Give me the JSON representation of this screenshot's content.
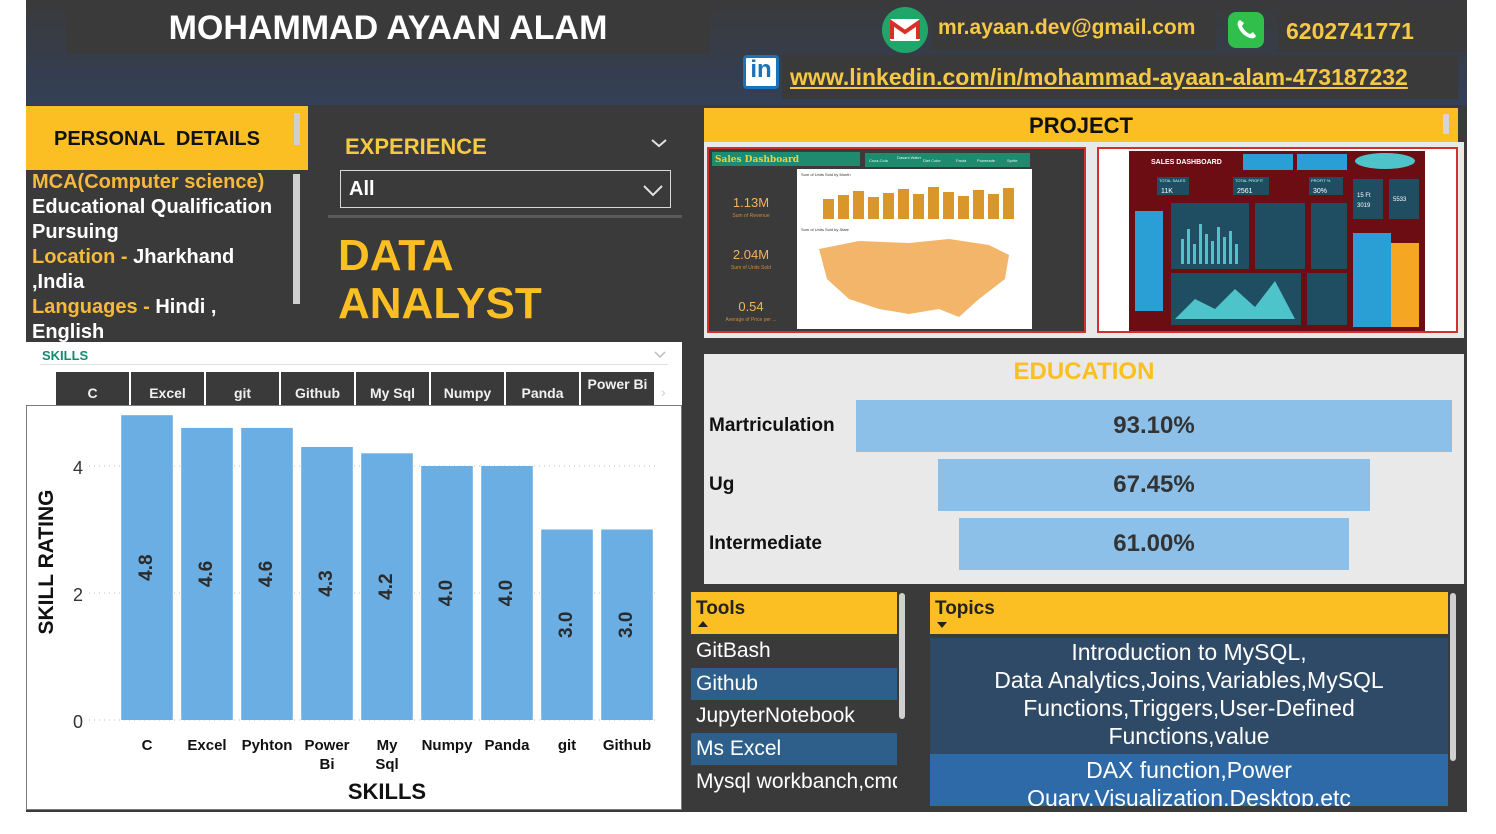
{
  "header": {
    "name": "MOHAMMAD AYAAN ALAM",
    "email": "mr.ayaan.dev@gmail.com",
    "phone": "6202741771",
    "linkedin": "www.linkedin.com/in/mohammad-ayaan-alam-473187232",
    "icons": [
      "gmail-icon",
      "phone-icon",
      "linkedin-icon"
    ]
  },
  "personal_details": {
    "title": "PERSONAL  DETAILS",
    "degree": "MCA(Computer science)",
    "qualification_line1": "Educational Qualification",
    "qualification_line2": "Pursuing",
    "location_label": "Location - ",
    "location_value": "Jharkhand",
    "location_value2": ",India",
    "languages_label": "Languages - ",
    "languages_value": "Hindi ,",
    "languages_value2": "English"
  },
  "experience": {
    "title": "EXPERIENCE",
    "selected": "All",
    "role_line1": "DATA",
    "role_line2": "ANALYST"
  },
  "skills_slicer": {
    "title": "SKILLS",
    "chips": [
      "C",
      "Excel",
      "git",
      "Github",
      "My Sql",
      "Numpy",
      "Panda",
      "Power Bi"
    ]
  },
  "project": {
    "title": "PROJECT",
    "thumb1": {
      "header": "Sales Dashboard",
      "kpis": [
        {
          "value": "1.13M",
          "label": "Sum of Revenue"
        },
        {
          "value": "2.04M",
          "label": "Sum of Units Sold"
        },
        {
          "value": "0.54",
          "label": "Average of Price per ..."
        }
      ],
      "tabs": [
        "Coca-Cola",
        "Dasani Water",
        "Diet Coke",
        "Fanta",
        "Powerade",
        "Sprite"
      ],
      "chart1_title": "Sum of Units Sold by Month",
      "chart2_title": "Sum of Units Sold by State"
    },
    "thumb2": {
      "header": "SALES DASHBOARD",
      "kpis": [
        {
          "label": "TOTAL SALES",
          "value": "11K"
        },
        {
          "label": "TOTAL PROFIT",
          "value": "2561"
        },
        {
          "label": "PROFIT %",
          "value": "30%"
        }
      ],
      "side_kpis": [
        "15 Ft",
        "3019",
        "5533"
      ]
    }
  },
  "education": {
    "title": "EDUCATION",
    "rows": [
      {
        "label": "Martriculation",
        "value": "93.10%",
        "pct": 93.1
      },
      {
        "label": "Ug",
        "value": "67.45%",
        "pct": 67.45
      },
      {
        "label": "Intermediate",
        "value": "61.00%",
        "pct": 61.0
      }
    ]
  },
  "tools": {
    "title": "Tools",
    "items": [
      "GitBash",
      "Github",
      "JupyterNotebook",
      "Ms Excel",
      "Mysql workbanch,cmd"
    ]
  },
  "topics": {
    "title": "Topics",
    "item1": [
      "Introduction to MySQL,",
      "Data Analytics,Joins,Variables,MySQL",
      "Functions,Triggers,User-Defined",
      "Functions,value"
    ],
    "item2": [
      "DAX function,Power",
      "Quary,Visualization,Desktop,etc"
    ]
  },
  "colors": {
    "accent": "#fbbf23",
    "panel": "#3a3a3a",
    "bar": "#6baee3",
    "edu_bar": "#8cc0e8",
    "row_blue": "#2e5f8a"
  },
  "chart_data": {
    "type": "bar",
    "xlabel": "SKILLS",
    "ylabel": "SKILL RATING",
    "categories": [
      "C",
      "Excel",
      "Pyhton",
      "Power Bi",
      "My Sql",
      "Numpy",
      "Panda",
      "git",
      "Github"
    ],
    "values": [
      4.8,
      4.6,
      4.6,
      4.3,
      4.2,
      4.0,
      4.0,
      3.0,
      3.0
    ],
    "value_labels": [
      "4.8",
      "4.6",
      "4.6",
      "4.3",
      "4.2",
      "4.0",
      "4.0",
      "3.0",
      "3.0"
    ],
    "yticks": [
      "0",
      "2",
      "4"
    ],
    "ylim": [
      0,
      5
    ],
    "grid": true
  }
}
